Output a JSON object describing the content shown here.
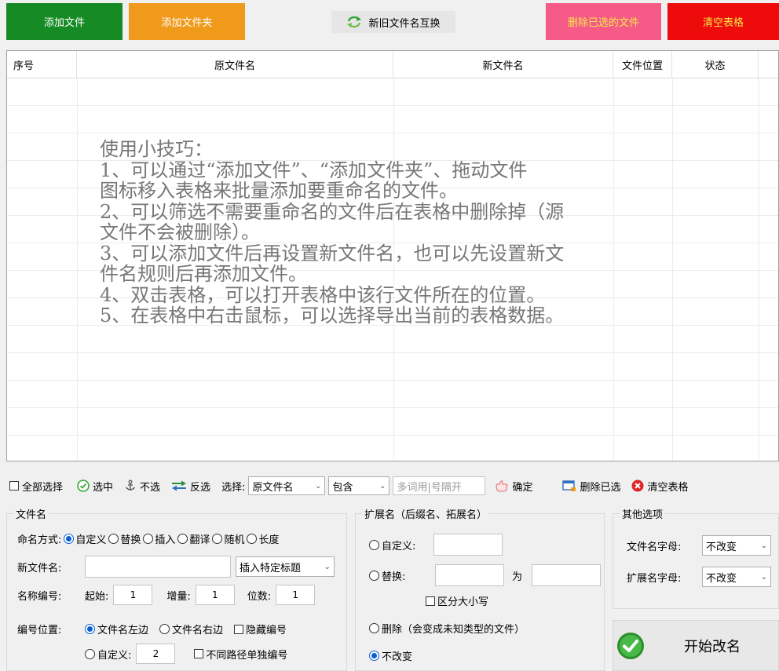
{
  "top_buttons": {
    "add_file": "添加文件",
    "add_folder": "添加文件夹",
    "swap_names": "新旧文件名互换",
    "delete_selected": "删除已选的文件",
    "clear_table": "清空表格"
  },
  "colors": {
    "add_file_bg": "#168a24",
    "add_folder_bg": "#f09a1c",
    "delete_selected_bg": "#f55b86",
    "clear_table_bg": "#ee0b0b",
    "delete_selected_text": "#f5e94a",
    "clear_table_text": "#f5e94a",
    "radio_accent": "#0a5fd6"
  },
  "table": {
    "columns": [
      "序号",
      "原文件名",
      "新文件名",
      "文件位置",
      "状态"
    ],
    "tips": [
      "使用小技巧：",
      "1、可以通过“添加文件”、“添加文件夹”、拖动文件",
      "图标移入表格来批量添加要重命名的文件。",
      "2、可以筛选不需要重命名的文件后在表格中删除掉（源",
      "文件不会被删除）。",
      "3、可以添加文件后再设置新文件名，也可以先设置新文",
      "件名规则后再添加文件。",
      "4、双击表格，可以打开表格中该行文件所在的位置。",
      "5、在表格中右击鼠标，可以选择导出当前的表格数据。"
    ]
  },
  "toolbar": {
    "select_all": "全部选择",
    "check": "选中",
    "uncheck": "不选",
    "invert": "反选",
    "select_label": "选择:",
    "select_field": "原文件名",
    "select_mode": "包含",
    "keyword_placeholder": "多词用|号隔开",
    "confirm": "确定",
    "delete_checked": "删除已选",
    "clear_table": "清空表格"
  },
  "filename_group": {
    "title": "文件名",
    "mode_label": "命名方式:",
    "modes": [
      "自定义",
      "替换",
      "插入",
      "翻译",
      "随机",
      "长度"
    ],
    "new_name_label": "新文件名:",
    "new_name_value": "",
    "insert_title": "插入特定标题",
    "number_label": "名称编号:",
    "start_label": "起始:",
    "start_value": "1",
    "step_label": "增量:",
    "step_value": "1",
    "digits_label": "位数:",
    "digits_value": "1",
    "position_label": "编号位置:",
    "pos_left": "文件名左边",
    "pos_right": "文件名右边",
    "hide_number": "隐藏编号",
    "pos_custom": "自定义:",
    "pos_custom_value": "2",
    "separate_number": "不同路径单独编号"
  },
  "extension_group": {
    "title": "扩展名（后缀名、拓展名）",
    "custom": "自定义:",
    "replace": "替换:",
    "to": "为",
    "case_sensitive": "区分大小写",
    "delete": "删除（会变成未知类型的文件）",
    "no_change": "不改变"
  },
  "other_group": {
    "title": "其他选项",
    "filename_case_label": "文件名字母:",
    "filename_case_value": "不改变",
    "ext_case_label": "扩展名字母:",
    "ext_case_value": "不改变"
  },
  "start_button": "开始改名"
}
